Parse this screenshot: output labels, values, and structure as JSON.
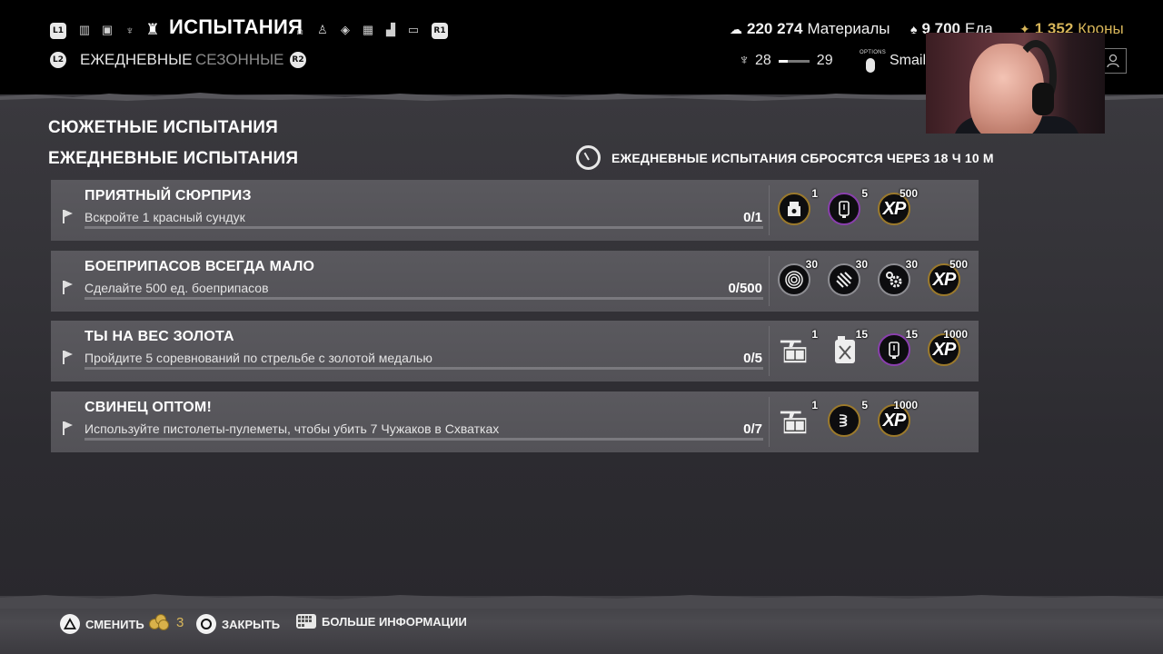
{
  "header": {
    "title": "ИСПЫТАНИЯ",
    "left_shoulder": "L1",
    "right_shoulder": "R1",
    "tab_icons": [
      "map-icon",
      "bag-icon",
      "skill-icon",
      "challenges-icon",
      "base-icon",
      "outfit-icon",
      "crafting-icon",
      "codex-icon",
      "stats-icon",
      "photo-icon"
    ],
    "subtabs": {
      "left_trigger": "L2",
      "daily": "ЕЖЕДНЕВНЫЕ",
      "seasonal": "СЕЗОННЫЕ",
      "right_trigger": "R2"
    }
  },
  "resources": {
    "materials_value": "220 274",
    "materials_label": "Материалы",
    "food_value": "9 700",
    "food_label": "Еда",
    "crowns_value": "1 352",
    "crowns_label": "Кроны"
  },
  "player": {
    "level_current": "28",
    "level_next": "29",
    "level_progress": 0.3,
    "options_label": "OPTIONS",
    "name": "Smail"
  },
  "sections": {
    "story_title": "СЮЖЕТНЫЕ ИСПЫТАНИЯ",
    "daily_title": "ЕЖЕДНЕВНЫЕ ИСПЫТАНИЯ",
    "reset_text": "ЕЖЕДНЕВНЫЕ ИСПЫТАНИЯ СБРОСЯТСЯ ЧЕРЕЗ 18 Ч 10 М"
  },
  "challenges": [
    {
      "name": "ПРИЯТНЫЙ СЮРПРИЗ",
      "desc": "Вскройте 1 красный сундук",
      "progress": "0/1",
      "rewards": [
        {
          "icon": "supply-crate-icon",
          "qty": "1"
        },
        {
          "icon": "battery-icon",
          "qty": "5"
        },
        {
          "icon": "xp-icon",
          "qty": "500"
        }
      ]
    },
    {
      "name": "БОЕПРИПАСОВ ВСЕГДА МАЛО",
      "desc": "Сделайте 500 ед. боеприпасов",
      "progress": "0/500",
      "rewards": [
        {
          "icon": "wire-coil-icon",
          "qty": "30"
        },
        {
          "icon": "pipes-icon",
          "qty": "30"
        },
        {
          "icon": "gears-icon",
          "qty": "30"
        },
        {
          "icon": "xp-icon",
          "qty": "500"
        }
      ]
    },
    {
      "name": "ТЫ НА ВЕС ЗОЛОТА",
      "desc": "Пройдите 5 соревнований по стрельбе с золотой медалью",
      "progress": "0/5",
      "rewards": [
        {
          "icon": "weapon-crate-icon",
          "qty": "1"
        },
        {
          "icon": "fuel-can-icon",
          "qty": "15"
        },
        {
          "icon": "battery-icon",
          "qty": "15"
        },
        {
          "icon": "xp-icon",
          "qty": "1000"
        }
      ]
    },
    {
      "name": "СВИНЕЦ ОПТОМ!",
      "desc": "Используйте пистолеты-пулеметы, чтобы убить 7 Чужаков в Схватках",
      "progress": "0/7",
      "rewards": [
        {
          "icon": "weapon-crate-icon",
          "qty": "1"
        },
        {
          "icon": "spring-icon",
          "qty": "5"
        },
        {
          "icon": "xp-icon",
          "qty": "1000"
        }
      ]
    }
  ],
  "footer": {
    "switch_label": "СМЕНИТЬ",
    "coins_count": "3",
    "close_label": "ЗАКРЫТЬ",
    "more_label": "БОЛЬШЕ ИНФОРМАЦИИ"
  },
  "colors": {
    "crowns": "#d8b65a",
    "panel": "#57565b",
    "xp_border_gold": "#9c7a2b",
    "battery_border_purple": "#8a3fae"
  }
}
